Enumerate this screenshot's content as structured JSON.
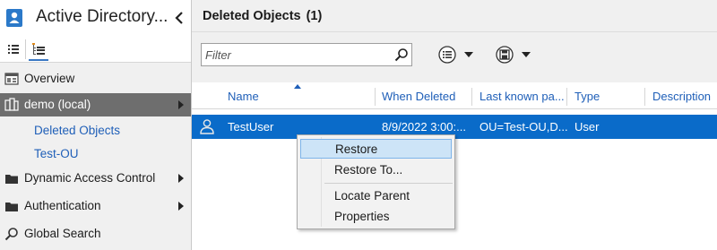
{
  "app": {
    "title": "Active Directory...",
    "accent_color": "#0a6bc9",
    "selected_nav_color": "#6e6e6e"
  },
  "sidebar": {
    "items": [
      {
        "label": "Overview",
        "icon": "overview-icon"
      },
      {
        "label": "demo (local)",
        "icon": "domain-icon",
        "selected": true
      },
      {
        "label": "Deleted Objects",
        "indent": 1
      },
      {
        "label": "Test-OU",
        "indent": 1
      },
      {
        "label": "Dynamic Access Control",
        "icon": "folder-icon"
      },
      {
        "label": "Authentication",
        "icon": "folder-icon"
      },
      {
        "label": "Global Search",
        "icon": "search-icon"
      }
    ]
  },
  "main": {
    "title": "Deleted Objects",
    "count": "(1)",
    "filter": {
      "placeholder": "Filter",
      "value": ""
    },
    "columns": [
      "Name",
      "When Deleted",
      "Last known pa...",
      "Type",
      "Description"
    ],
    "sorted_column": "Name",
    "rows": [
      {
        "name": "TestUser",
        "when_deleted": "8/9/2022 3:00:...",
        "last_known_parent": "OU=Test-OU,D...",
        "type": "User",
        "description": "",
        "selected": true
      }
    ]
  },
  "context_menu": {
    "items": [
      "Restore",
      "Restore To...",
      "Locate Parent",
      "Properties"
    ],
    "highlighted": "Restore"
  }
}
